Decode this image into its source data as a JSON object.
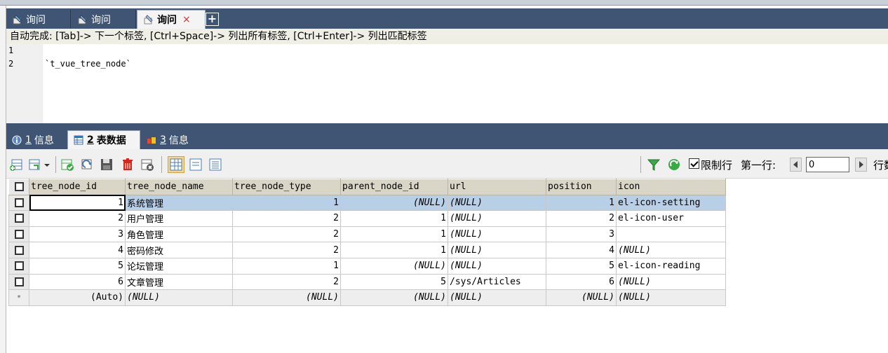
{
  "query_tabs": [
    {
      "label": "询问",
      "active": false
    },
    {
      "label": "询问",
      "active": false
    },
    {
      "label": "询问",
      "active": true,
      "close": "×"
    }
  ],
  "add_tab_label": "+",
  "editor": {
    "hint": "自动完成: [Tab]-> 下一个标签, [Ctrl+Space]-> 列出所有标签, [Ctrl+Enter]-> 列出匹配标签",
    "line_numbers": [
      "1",
      "2"
    ],
    "lines": [
      "",
      "`t_vue_tree_node`"
    ]
  },
  "result_tabs": [
    {
      "num": "1",
      "label": "信息",
      "active": false
    },
    {
      "num": "2",
      "label": "表数据",
      "active": true
    },
    {
      "num": "3",
      "label": "信息",
      "active": false
    }
  ],
  "toolbar": {
    "limit_rows_label": "限制行",
    "first_row_label": "第一行:",
    "first_row_value": "0",
    "rows_label": "行数"
  },
  "grid": {
    "columns": [
      "tree_node_id",
      "tree_node_name",
      "tree_node_type",
      "parent_node_id",
      "url",
      "position",
      "icon"
    ],
    "rows": [
      [
        "1",
        "系统管理",
        "1",
        "(NULL)",
        "(NULL)",
        "1",
        "el-icon-setting"
      ],
      [
        "2",
        "用户管理",
        "2",
        "1",
        "(NULL)",
        "2",
        "el-icon-user"
      ],
      [
        "3",
        "角色管理",
        "2",
        "1",
        "(NULL)",
        "3",
        ""
      ],
      [
        "4",
        "密码修改",
        "2",
        "1",
        "(NULL)",
        "4",
        "(NULL)"
      ],
      [
        "5",
        "论坛管理",
        "1",
        "(NULL)",
        "(NULL)",
        "5",
        "el-icon-reading"
      ],
      [
        "6",
        "文章管理",
        "2",
        "5",
        "/sys/Articles",
        "6",
        "(NULL)"
      ]
    ],
    "new_row": [
      "(Auto)",
      "(NULL)",
      "(NULL)",
      "(NULL)",
      "(NULL)",
      "(NULL)",
      "(NULL)"
    ],
    "new_row_marker": "*"
  }
}
